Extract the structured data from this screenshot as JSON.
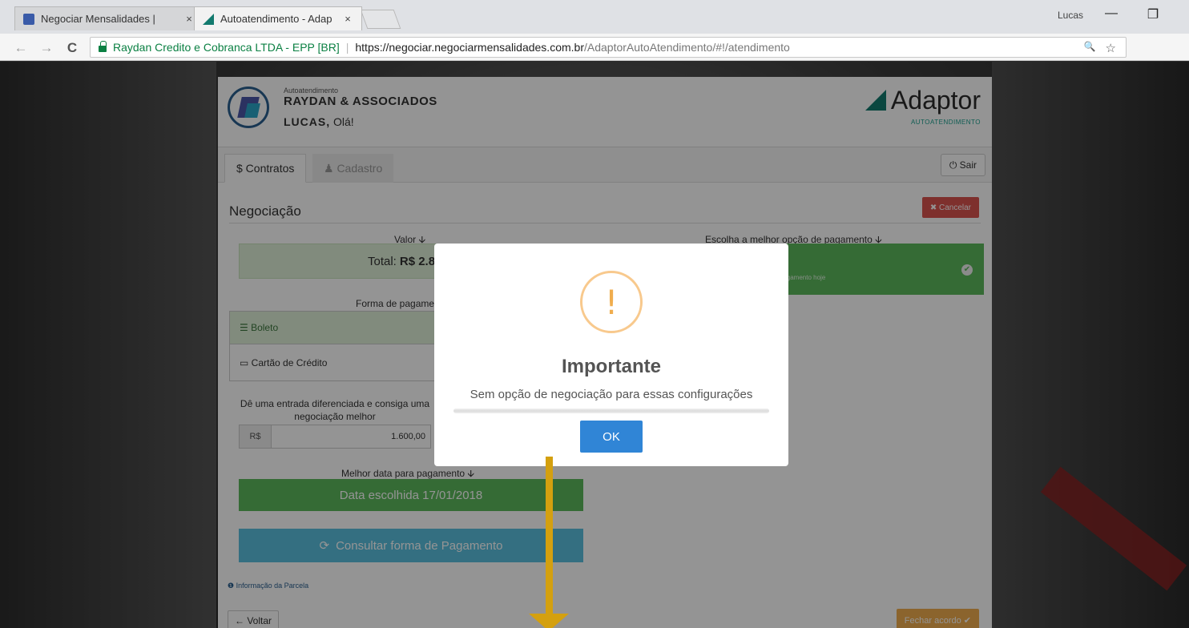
{
  "browser": {
    "tabs": [
      {
        "title": "Negociar Mensalidades |",
        "close": "×"
      },
      {
        "title": "Autoatendimento - Adap",
        "close": "×"
      }
    ],
    "window_user": "Lucas",
    "window_controls": {
      "minimize": "—",
      "restore": "❐"
    },
    "nav": {
      "back": "←",
      "forward": "→",
      "reload": "C"
    },
    "address": {
      "org": "Raydan Credito e Cobranca LTDA - EPP [BR]",
      "host": "https://negociar.negociarmensalidades.com.br",
      "path": "/AdaptorAutoAtendimento/#!/atendimento"
    },
    "icons": {
      "zoom": "🔍",
      "star": "☆"
    }
  },
  "app": {
    "header": {
      "small_label": "Autoatendimento",
      "company": "RAYDAN & ASSOCIADOS",
      "user_name": "LUCAS,",
      "greeting": "Olá!",
      "brand_name": "Adaptor",
      "brand_sub": "AUTOATENDIMENTO"
    },
    "tabs": {
      "contratos": "$ Contratos",
      "cadastro": "♟ Cadastro",
      "sair": "⏻ Sair"
    },
    "negociacao": {
      "title": "Negociação",
      "cancel": "✖ Cancelar",
      "valor_label": "Valor 🡫",
      "total_label": "Total:",
      "total_value": "R$ 2.89",
      "escolha_label": "Escolha a melhor opção de pagamento 🡫",
      "payopt_sub": "Pagamento hoje",
      "forma_label": "Forma de pagame",
      "formas": [
        "☰ Boleto",
        "▭ Cartão de Crédito"
      ],
      "entrada_text": "Dê uma entrada diferenciada e consiga uma negociação melhor",
      "entrada_prefix": "R$",
      "entrada_value": "1.600,00",
      "data_label": "Melhor data para pagamento 🡫",
      "data_value": "Data escolhida 17/01/2018",
      "consultar": "Consultar forma de Pagamento",
      "consultar_icon": "⟳",
      "info_parcela": "❶ Informação da Parcela",
      "voltar": "← Voltar",
      "fechar": "Fechar acordo ✔"
    }
  },
  "modal": {
    "icon": "!",
    "title": "Importante",
    "text": "Sem opção de negociação para essas configurações",
    "ok": "OK"
  },
  "colors": {
    "success": "#5cb85c",
    "info": "#5bc0de",
    "danger": "#d9534f",
    "warning": "#f0ad4e",
    "primary": "#3085d6",
    "annotation_arrow": "#d4a00f"
  }
}
